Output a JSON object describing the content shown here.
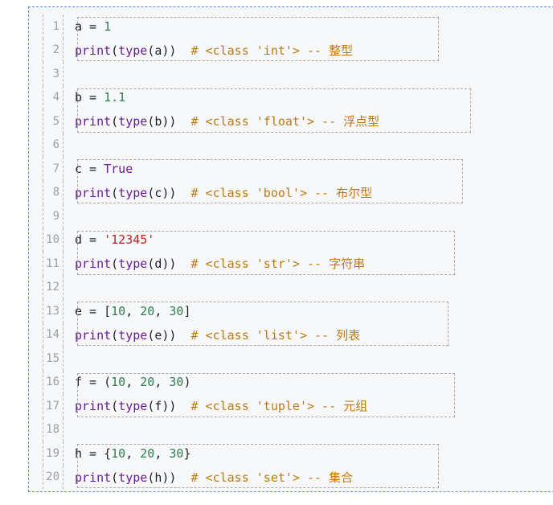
{
  "editor": {
    "lines": [
      {
        "n": "1",
        "tokens": [
          [
            "plain",
            "a = "
          ],
          [
            "num",
            "1"
          ]
        ]
      },
      {
        "n": "2",
        "tokens": [
          [
            "kw",
            "print"
          ],
          [
            "plain",
            "("
          ],
          [
            "kw",
            "type"
          ],
          [
            "plain",
            "(a))  "
          ],
          [
            "cm",
            "# <class 'int'> -- 整型"
          ]
        ]
      },
      {
        "n": "3",
        "tokens": []
      },
      {
        "n": "4",
        "tokens": [
          [
            "plain",
            "b = "
          ],
          [
            "num",
            "1.1"
          ]
        ]
      },
      {
        "n": "5",
        "tokens": [
          [
            "kw",
            "print"
          ],
          [
            "plain",
            "("
          ],
          [
            "kw",
            "type"
          ],
          [
            "plain",
            "(b))  "
          ],
          [
            "cm",
            "# <class 'float'> -- 浮点型"
          ]
        ]
      },
      {
        "n": "6",
        "tokens": []
      },
      {
        "n": "7",
        "tokens": [
          [
            "plain",
            "c = "
          ],
          [
            "kw",
            "True"
          ]
        ]
      },
      {
        "n": "8",
        "tokens": [
          [
            "kw",
            "print"
          ],
          [
            "plain",
            "("
          ],
          [
            "kw",
            "type"
          ],
          [
            "plain",
            "(c))  "
          ],
          [
            "cm",
            "# <class 'bool'> -- 布尔型"
          ]
        ]
      },
      {
        "n": "9",
        "tokens": []
      },
      {
        "n": "10",
        "tokens": [
          [
            "plain",
            "d = "
          ],
          [
            "str",
            "'12345'"
          ]
        ]
      },
      {
        "n": "11",
        "tokens": [
          [
            "kw",
            "print"
          ],
          [
            "plain",
            "("
          ],
          [
            "kw",
            "type"
          ],
          [
            "plain",
            "(d))  "
          ],
          [
            "cm",
            "# <class 'str'> -- 字符串"
          ]
        ]
      },
      {
        "n": "12",
        "tokens": []
      },
      {
        "n": "13",
        "tokens": [
          [
            "plain",
            "e = ["
          ],
          [
            "num",
            "10"
          ],
          [
            "plain",
            ", "
          ],
          [
            "num",
            "20"
          ],
          [
            "plain",
            ", "
          ],
          [
            "num",
            "30"
          ],
          [
            "plain",
            "]"
          ]
        ]
      },
      {
        "n": "14",
        "tokens": [
          [
            "kw",
            "print"
          ],
          [
            "plain",
            "("
          ],
          [
            "kw",
            "type"
          ],
          [
            "plain",
            "(e))  "
          ],
          [
            "cm",
            "# <class 'list'> -- 列表"
          ]
        ]
      },
      {
        "n": "15",
        "tokens": []
      },
      {
        "n": "16",
        "tokens": [
          [
            "plain",
            "f = ("
          ],
          [
            "num",
            "10"
          ],
          [
            "plain",
            ", "
          ],
          [
            "num",
            "20"
          ],
          [
            "plain",
            ", "
          ],
          [
            "num",
            "30"
          ],
          [
            "plain",
            ")"
          ]
        ]
      },
      {
        "n": "17",
        "tokens": [
          [
            "kw",
            "print"
          ],
          [
            "plain",
            "("
          ],
          [
            "kw",
            "type"
          ],
          [
            "plain",
            "(f))  "
          ],
          [
            "cm",
            "# <class 'tuple'> -- 元组"
          ]
        ]
      },
      {
        "n": "18",
        "tokens": []
      },
      {
        "n": "19",
        "tokens": [
          [
            "plain",
            "h = {"
          ],
          [
            "num",
            "10"
          ],
          [
            "plain",
            ", "
          ],
          [
            "num",
            "20"
          ],
          [
            "plain",
            ", "
          ],
          [
            "num",
            "30"
          ],
          [
            "plain",
            "}"
          ]
        ]
      },
      {
        "n": "20",
        "tokens": [
          [
            "kw",
            "print"
          ],
          [
            "plain",
            "("
          ],
          [
            "kw",
            "type"
          ],
          [
            "plain",
            "(h))  "
          ],
          [
            "cm",
            "# <class 'set'> -- 集合"
          ]
        ]
      }
    ]
  },
  "colors": {
    "keyword": "#6a1b9a",
    "number": "#2e7d4f",
    "string": "#b3261e",
    "comment": "#c0790f",
    "frame_border": "#5b8bd6"
  }
}
